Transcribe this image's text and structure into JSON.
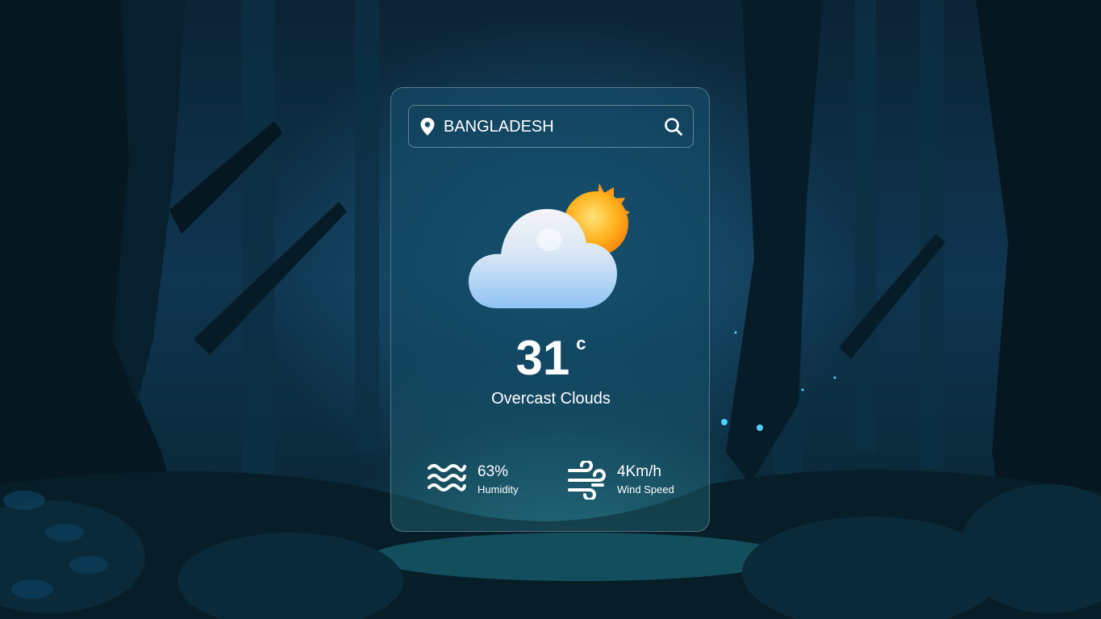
{
  "search": {
    "value": "BANGLADESH"
  },
  "weather": {
    "temperature": "31",
    "unit": "c",
    "condition": "Overcast Clouds",
    "icon": "sun-behind-cloud-icon"
  },
  "details": {
    "humidity": {
      "value": "63%",
      "label": "Humidity",
      "icon": "humidity-waves-icon"
    },
    "wind": {
      "value": "4Km/h",
      "label": "Wind Speed",
      "icon": "wind-icon"
    }
  },
  "colors": {
    "text": "#ffffff",
    "sun": "#ffb020",
    "cloud": "#a8d4f5"
  }
}
